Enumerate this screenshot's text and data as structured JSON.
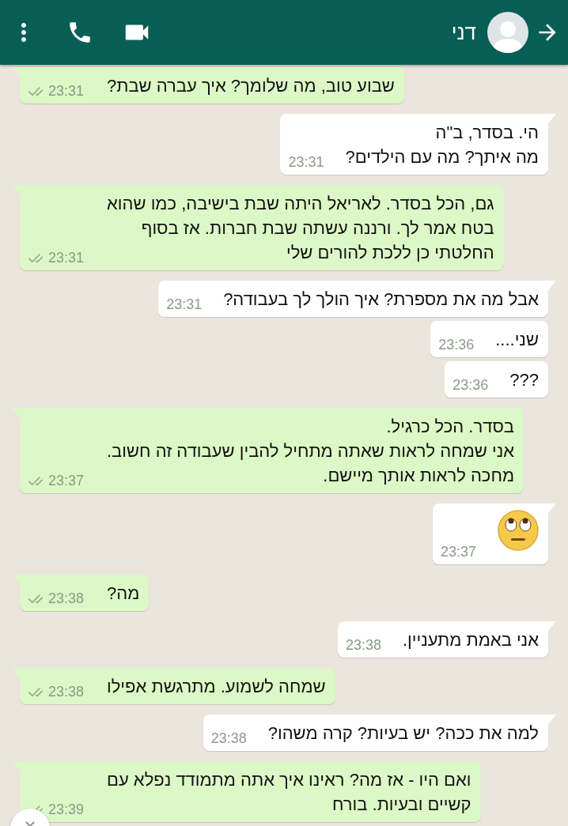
{
  "header": {
    "contact_name": "דני"
  },
  "messages": [
    {
      "outgoing": true,
      "delivered": true,
      "kind": "text",
      "text": "שבוע טוב, מה שלומך? איך עברה שבת?",
      "time": "23:31"
    },
    {
      "outgoing": false,
      "kind": "text",
      "text": "הי. בסדר, ב\"ה\nמה איתך? מה עם הילדים?",
      "time": "23:31"
    },
    {
      "outgoing": true,
      "delivered": true,
      "kind": "text",
      "text": "גם, הכל בסדר. לאריאל היתה שבת בישיבה, כמו שהוא\nבטח אמר לך. ורננה עשתה שבת חברות. אז בסוף\nהחלטתי כן ללכת להורים שלי",
      "time": "23:31"
    },
    {
      "outgoing": false,
      "kind": "text",
      "text": "אבל מה את מספרת? איך הולך לך בעבודה?",
      "time": "23:31"
    },
    {
      "outgoing": false,
      "kind": "text",
      "text": "שני....",
      "time": "23:36"
    },
    {
      "outgoing": false,
      "kind": "text",
      "text": "???",
      "time": "23:36"
    },
    {
      "outgoing": true,
      "delivered": true,
      "kind": "text",
      "text": "בסדר. הכל כרגיל.\nאני שמחה לראות שאתה מתחיל להבין שעבודה זה חשוב.\nמחכה לראות אותך מיישם.",
      "time": "23:37"
    },
    {
      "outgoing": false,
      "kind": "emoji",
      "time": "23:37"
    },
    {
      "outgoing": true,
      "delivered": true,
      "kind": "text",
      "text": "מה?",
      "time": "23:38"
    },
    {
      "outgoing": false,
      "kind": "text",
      "text": "אני באמת מתעניין.",
      "time": "23:38"
    },
    {
      "outgoing": true,
      "delivered": true,
      "kind": "text",
      "text": "שמחה לשמוע. מתרגשת אפילו",
      "time": "23:38"
    },
    {
      "outgoing": false,
      "kind": "text",
      "text": "למה את ככה? יש בעיות? קרה משהו?",
      "time": "23:38"
    },
    {
      "outgoing": true,
      "delivered": true,
      "kind": "text",
      "text": "ואם היו - אז מה? ראינו איך אתה מתמודד נפלא עם\nקשיים ובעיות. בורח",
      "time": "23:39"
    }
  ]
}
